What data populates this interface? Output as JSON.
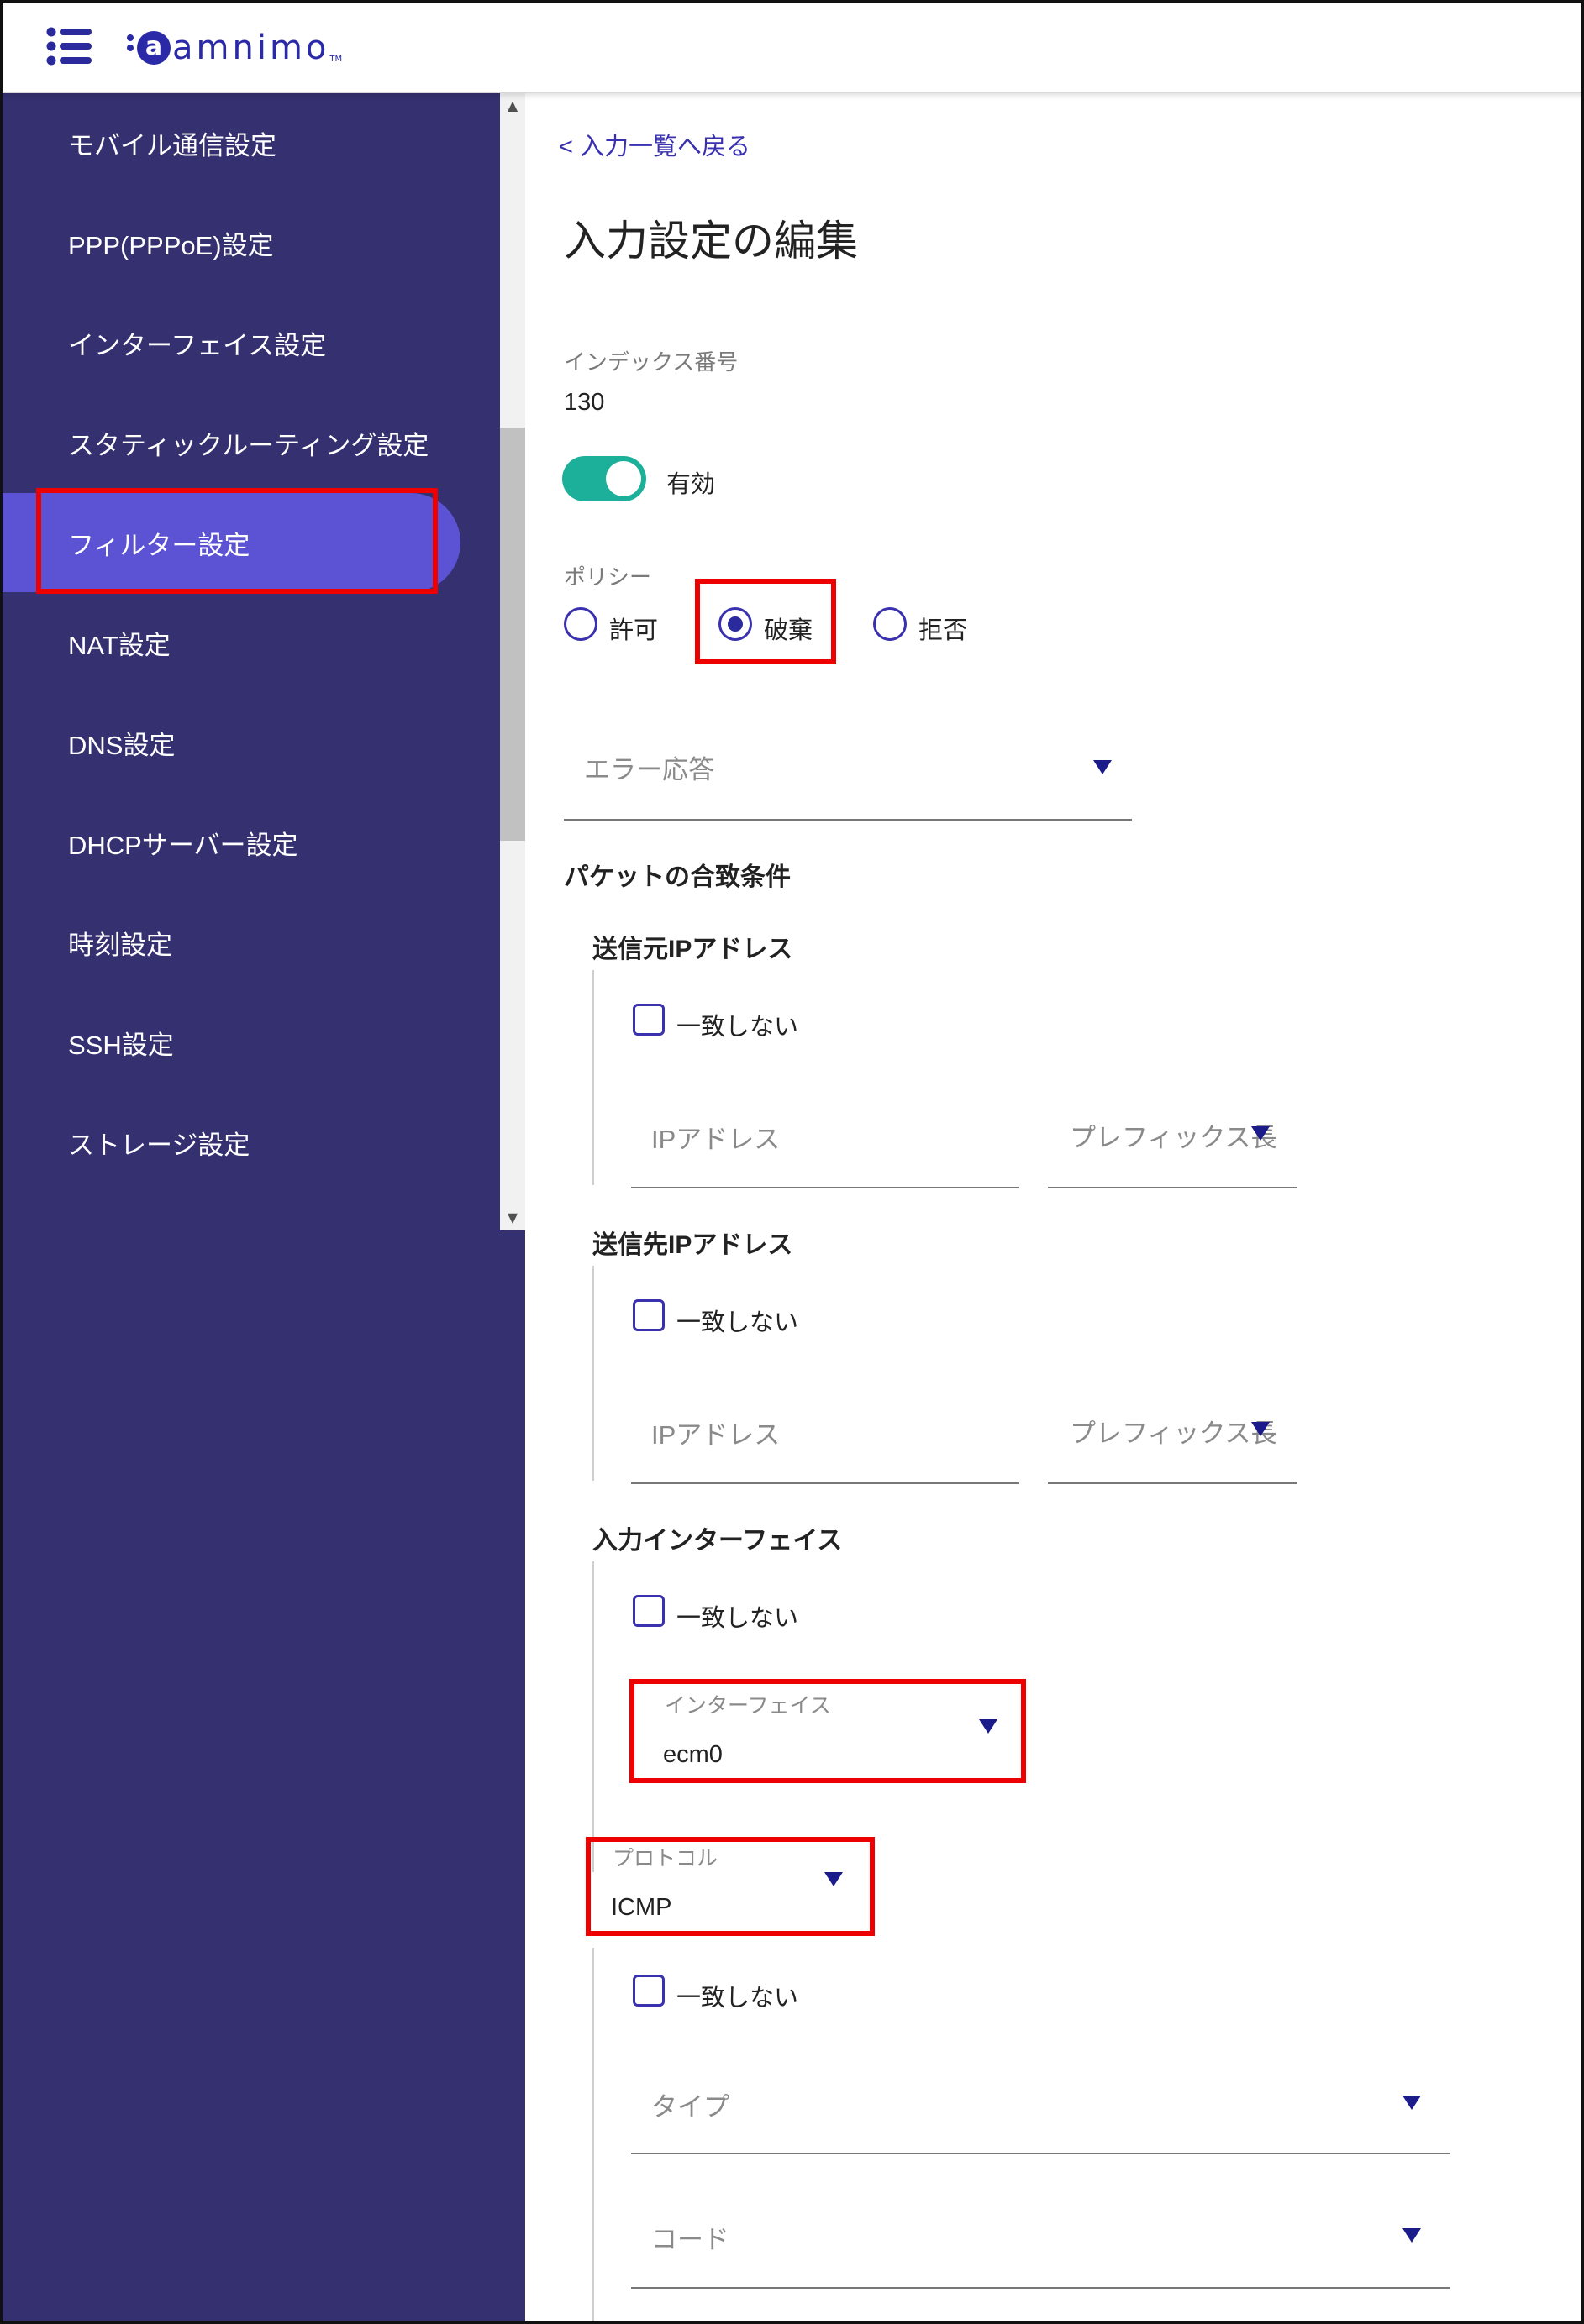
{
  "header": {
    "logo_text": "amnimo",
    "logo_mark": "a",
    "logo_tm": "TM"
  },
  "sidebar": {
    "items": [
      {
        "label": "モバイル通信設定",
        "active": false
      },
      {
        "label": "PPP(PPPoE)設定",
        "active": false
      },
      {
        "label": "インターフェイス設定",
        "active": false
      },
      {
        "label": "スタティックルーティング設定",
        "active": false
      },
      {
        "label": "フィルター設定",
        "active": true
      },
      {
        "label": "NAT設定",
        "active": false
      },
      {
        "label": "DNS設定",
        "active": false
      },
      {
        "label": "DHCPサーバー設定",
        "active": false
      },
      {
        "label": "時刻設定",
        "active": false
      },
      {
        "label": "SSH設定",
        "active": false
      },
      {
        "label": "ストレージ設定",
        "active": false
      }
    ]
  },
  "main": {
    "back_link": "< 入力一覧へ戻る",
    "title": "入力設定の編集",
    "index_label": "インデックス番号",
    "index_value": "130",
    "enabled_label": "有効",
    "policy_label": "ポリシー",
    "policy_options": [
      "許可",
      "破棄",
      "拒否"
    ],
    "policy_selected": "破棄",
    "error_response_placeholder": "エラー応答",
    "packet_match_title": "パケットの合致条件",
    "source_ip": {
      "title": "送信元IPアドレス",
      "no_match_label": "一致しない",
      "ip_placeholder": "IPアドレス",
      "prefix_placeholder": "プレフィックス長"
    },
    "dest_ip": {
      "title": "送信先IPアドレス",
      "no_match_label": "一致しない",
      "ip_placeholder": "IPアドレス",
      "prefix_placeholder": "プレフィックス長"
    },
    "input_interface": {
      "title": "入力インターフェイス",
      "no_match_label": "一致しない",
      "field_label": "インターフェイス",
      "field_value": "ecm0"
    },
    "protocol": {
      "field_label": "プロトコル",
      "field_value": "ICMP",
      "no_match_label": "一致しない",
      "type_placeholder": "タイプ",
      "code_placeholder": "コード"
    }
  },
  "colors": {
    "sidebar_bg": "#353070",
    "sidebar_active": "#5c52d4",
    "accent": "#3a31b0",
    "toggle_on": "#1cb09a",
    "highlight": "#ee0000"
  }
}
